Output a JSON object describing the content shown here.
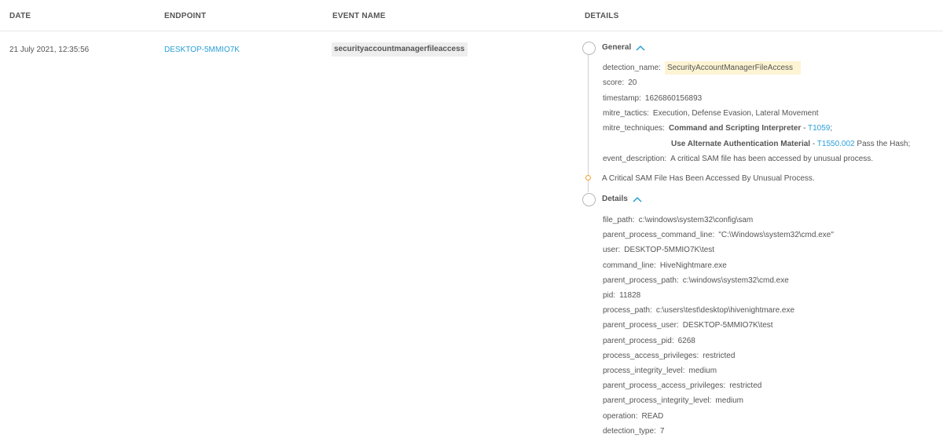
{
  "headers": {
    "date": "DATE",
    "endpoint": "ENDPOINT",
    "event_name": "EVENT NAME",
    "details": "DETAILS"
  },
  "row": {
    "date": "21 July 2021, 12:35:56",
    "endpoint": "DESKTOP-5MMIO7K",
    "event_name": "securityaccountmanagerfileaccess"
  },
  "general": {
    "title": "General",
    "detection_name": {
      "k": "detection_name:",
      "v": "SecurityAccountManagerFileAccess"
    },
    "score": {
      "k": "score:",
      "v": "20"
    },
    "timestamp": {
      "k": "timestamp:",
      "v": "1626860156893"
    },
    "mitre_tactics": {
      "k": "mitre_tactics:",
      "v": "Execution, Defense Evasion, Lateral Movement"
    },
    "mitre_techniques": {
      "k": "mitre_techniques:",
      "t1_name": "Command and Scripting Interpreter",
      "t1_sep": " - ",
      "t1_id": "T1059",
      "t1_end": ";",
      "t2_name": "Use Alternate Authentication Material",
      "t2_sep": " - ",
      "t2_id": "T1550.002",
      "t2_end": " Pass the Hash;"
    },
    "event_description": {
      "k": "event_description:",
      "v": "A critical SAM file has been accessed by unusual process."
    }
  },
  "note": "A Critical SAM File Has Been Accessed By Unusual Process.",
  "details": {
    "title": "Details",
    "items": [
      {
        "k": "file_path:",
        "v": "c:\\windows\\system32\\config\\sam"
      },
      {
        "k": "parent_process_command_line:",
        "v": "\"C:\\Windows\\system32\\cmd.exe\""
      },
      {
        "k": "user:",
        "v": "DESKTOP-5MMIO7K\\test"
      },
      {
        "k": "command_line:",
        "v": "HiveNightmare.exe"
      },
      {
        "k": "parent_process_path:",
        "v": "c:\\windows\\system32\\cmd.exe"
      },
      {
        "k": "pid:",
        "v": "11828"
      },
      {
        "k": "process_path:",
        "v": "c:\\users\\test\\desktop\\hivenightmare.exe"
      },
      {
        "k": "parent_process_user:",
        "v": "DESKTOP-5MMIO7K\\test"
      },
      {
        "k": "parent_process_pid:",
        "v": "6268"
      },
      {
        "k": "process_access_privileges:",
        "v": "restricted"
      },
      {
        "k": "process_integrity_level:",
        "v": "medium"
      },
      {
        "k": "parent_process_access_privileges:",
        "v": "restricted"
      },
      {
        "k": "parent_process_integrity_level:",
        "v": "medium"
      },
      {
        "k": "operation:",
        "v": "READ"
      },
      {
        "k": "detection_type:",
        "v": "7"
      }
    ]
  },
  "colors": {
    "link": "#2a9fd8",
    "highlight": "#fdf4d3",
    "timeline_dot": "#f0a030"
  }
}
